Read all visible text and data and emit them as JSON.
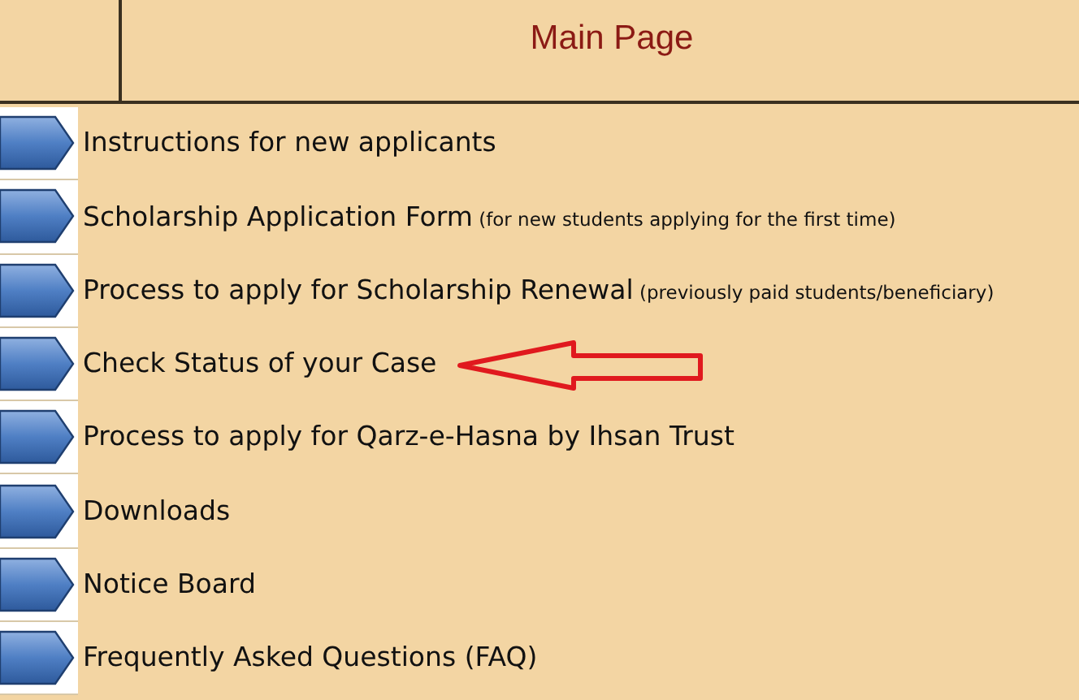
{
  "header": {
    "title": "Main Page"
  },
  "links": [
    {
      "label": "Instructions for new applicants",
      "marked": false
    },
    {
      "label": "Scholarship Application Form",
      "note": "(for new students applying for the first time)",
      "marked": false
    },
    {
      "label": "Process to apply for Scholarship Renewal",
      "note": "(previously paid students/beneficiary)",
      "marked": false
    },
    {
      "label": "Check Status of your Case",
      "marked": true
    },
    {
      "label": "Process to apply for Qarz-e-Hasna by Ihsan Trust",
      "marked": false
    },
    {
      "label": "Downloads",
      "marked": false
    },
    {
      "label": "Notice Board",
      "marked": false
    },
    {
      "label": "Frequently Asked Questions (FAQ)",
      "marked": false
    }
  ]
}
